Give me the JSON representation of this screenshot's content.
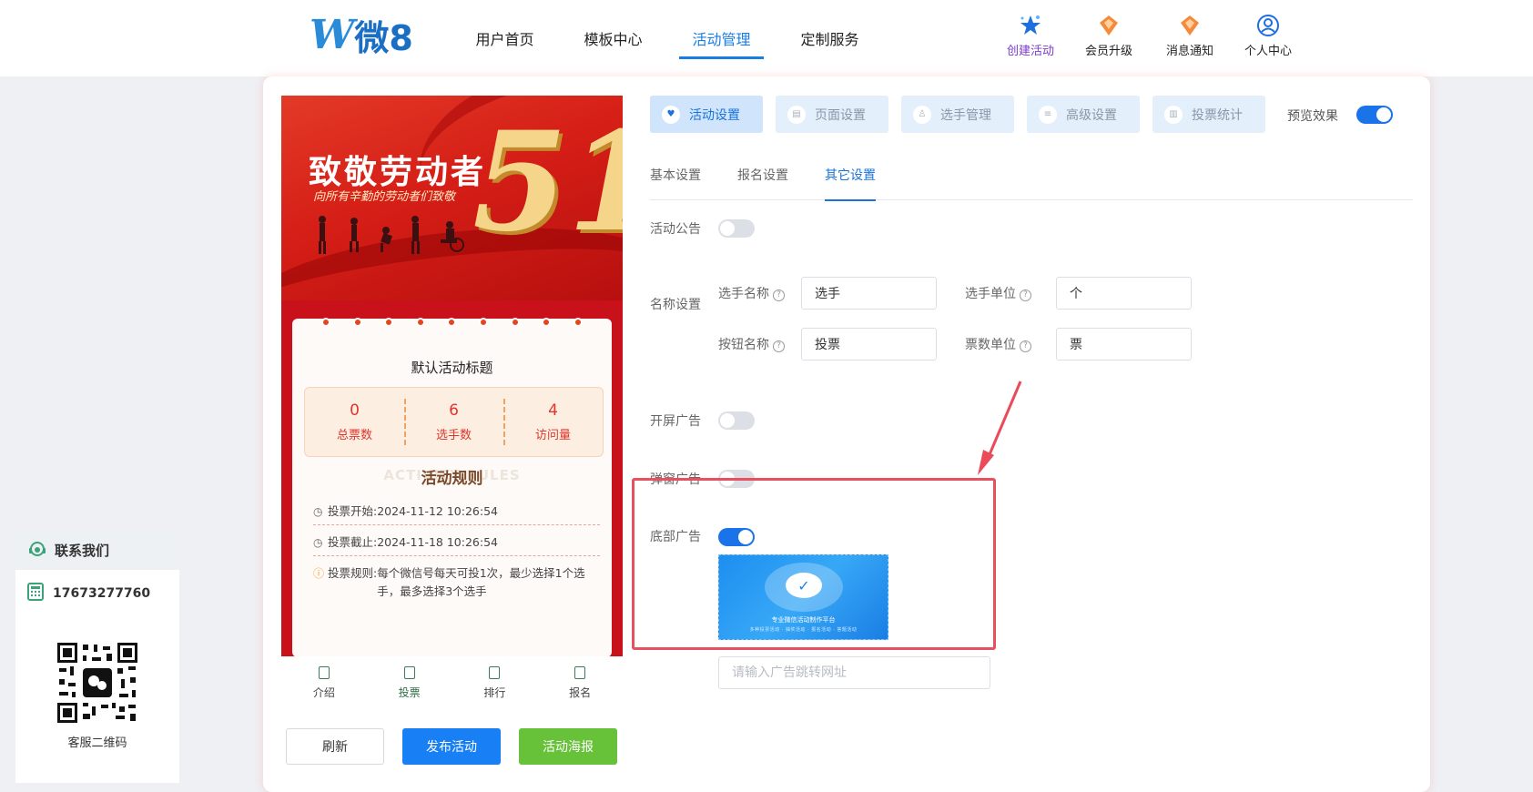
{
  "brand": {
    "logo_w": "W",
    "logo_text": "微8"
  },
  "nav": [
    {
      "label": "用户首页",
      "active": false
    },
    {
      "label": "模板中心",
      "active": false
    },
    {
      "label": "活动管理",
      "active": true
    },
    {
      "label": "定制服务",
      "active": false
    }
  ],
  "quick": {
    "create": "创建活动",
    "upgrade": "会员升级",
    "notify": "消息通知",
    "profile": "个人中心"
  },
  "preview": {
    "banner_title": "致敬劳动者",
    "banner_sub": "向所有辛勤的劳动者们致敬",
    "banner_number": "51",
    "activity_title": "默认活动标题",
    "stats": [
      {
        "value": "0",
        "label": "总票数"
      },
      {
        "value": "6",
        "label": "选手数"
      },
      {
        "value": "4",
        "label": "访问量"
      }
    ],
    "rules_bg": "ACTIVITY RULES",
    "rules_title": "活动规则",
    "vote_start_label": "投票开始:",
    "vote_start": "2024-11-12 10:26:54",
    "vote_end_label": "投票截止:",
    "vote_end": "2024-11-18 10:26:54",
    "vote_rule_label": "投票规则:",
    "vote_rule": "每个微信号每天可投1次，最少选择1个选手，最多选择3个选手",
    "tabbar": [
      "介绍",
      "投票",
      "排行",
      "报名"
    ]
  },
  "actions": {
    "refresh": "刷新",
    "publish": "发布活动",
    "poster": "活动海报"
  },
  "settings_tabs": [
    "活动设置",
    "页面设置",
    "选手管理",
    "高级设置",
    "投票统计"
  ],
  "preview_toggle": {
    "label": "预览效果",
    "on": true
  },
  "sub_tabs": [
    "基本设置",
    "报名设置",
    "其它设置"
  ],
  "form": {
    "notice_label": "活动公告",
    "name_settings_label": "名称设置",
    "player_name_label": "选手名称",
    "player_name_value": "选手",
    "player_unit_label": "选手单位",
    "player_unit_value": "个",
    "button_name_label": "按钮名称",
    "button_name_value": "投票",
    "vote_unit_label": "票数单位",
    "vote_unit_value": "票",
    "splash_ad_label": "开屏广告",
    "popup_ad_label": "弹窗广告",
    "bottom_ad_label": "底部广告",
    "ad_img_title": "专业微信活动制作平台",
    "ad_img_sub": "多种投票活动 · 抽奖活动 · 报名活动 · 答题活动",
    "ad_url_placeholder": "请输入广告跳转网址"
  },
  "contact": {
    "title": "联系我们",
    "phone": "17673277760",
    "qr_label": "客服二维码"
  },
  "colors": {
    "accent": "#1a73d9",
    "publish": "#1880f4",
    "poster": "#67c23a",
    "highlight": "#e8505f"
  }
}
